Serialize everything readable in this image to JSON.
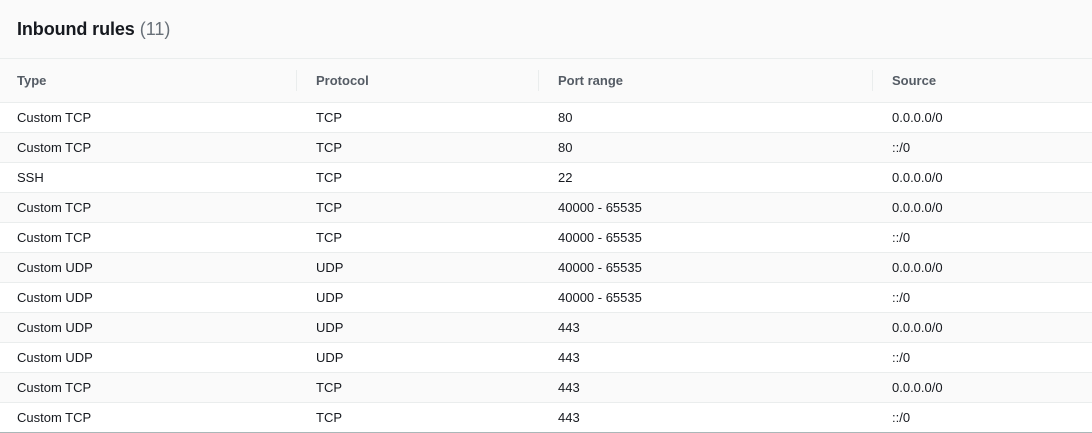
{
  "panel": {
    "title": "Inbound rules",
    "count": "(11)"
  },
  "table": {
    "columns": [
      "Type",
      "Protocol",
      "Port range",
      "Source"
    ],
    "rows": [
      [
        "Custom TCP",
        "TCP",
        "80",
        "0.0.0.0/0"
      ],
      [
        "Custom TCP",
        "TCP",
        "80",
        "::/0"
      ],
      [
        "SSH",
        "TCP",
        "22",
        "0.0.0.0/0"
      ],
      [
        "Custom TCP",
        "TCP",
        "40000 - 65535",
        "0.0.0.0/0"
      ],
      [
        "Custom TCP",
        "TCP",
        "40000 - 65535",
        "::/0"
      ],
      [
        "Custom UDP",
        "UDP",
        "40000 - 65535",
        "0.0.0.0/0"
      ],
      [
        "Custom UDP",
        "UDP",
        "40000 - 65535",
        "::/0"
      ],
      [
        "Custom UDP",
        "UDP",
        "443",
        "0.0.0.0/0"
      ],
      [
        "Custom UDP",
        "UDP",
        "443",
        "::/0"
      ],
      [
        "Custom TCP",
        "TCP",
        "443",
        "0.0.0.0/0"
      ],
      [
        "Custom TCP",
        "TCP",
        "443",
        "::/0"
      ]
    ]
  }
}
